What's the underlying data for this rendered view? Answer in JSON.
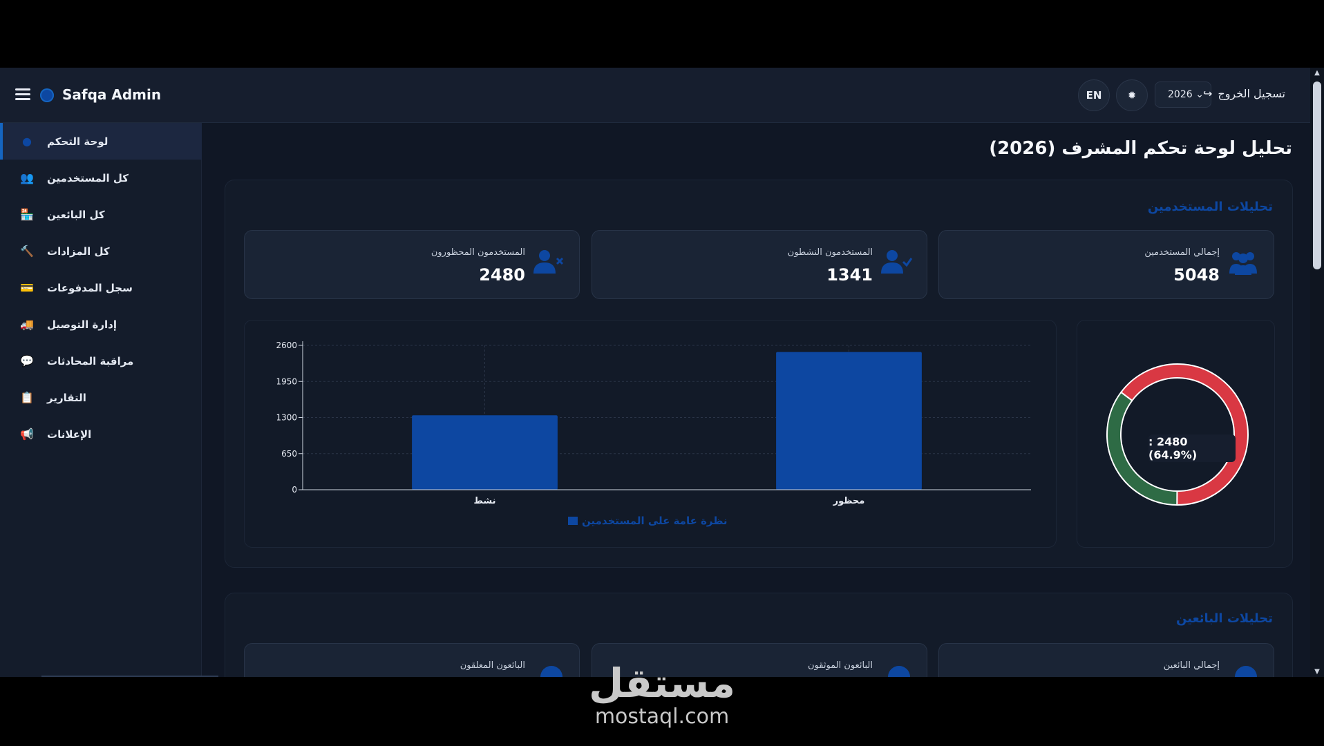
{
  "app": {
    "brand": "Safqa Admin"
  },
  "topbar": {
    "logout_label": "تسجيل الخروج",
    "logout_icon": "↪",
    "year": "2026",
    "lang": "EN",
    "settings_icon": "✹"
  },
  "sidebar": {
    "items": [
      {
        "label": "لوحة التحكم",
        "icon": "●",
        "active": true
      },
      {
        "label": "كل المستخدمين",
        "icon": "👥"
      },
      {
        "label": "كل البائعين",
        "icon": "🏪"
      },
      {
        "label": "كل المزادات",
        "icon": "🔨"
      },
      {
        "label": "سجل المدفوعات",
        "icon": "💳"
      },
      {
        "label": "إدارة التوصيل",
        "icon": "🚚"
      },
      {
        "label": "مراقبة المحادثات",
        "icon": "💬"
      },
      {
        "label": "التقارير",
        "icon": "📋"
      },
      {
        "label": "الإعلانات",
        "icon": "📢"
      }
    ]
  },
  "page": {
    "title": "تحليل لوحة تحكم المشرف (2026)"
  },
  "users_panel": {
    "title": "تحليلات المستخدمين",
    "cards": [
      {
        "label": "المستخدمون المحظورون",
        "value": "2480",
        "icon": "user-block-icon"
      },
      {
        "label": "المستخدمون النشطون",
        "value": "1341",
        "icon": "user-check-icon"
      },
      {
        "label": "إجمالي المستخدمين",
        "value": "5048",
        "icon": "users-icon"
      }
    ]
  },
  "sellers_panel": {
    "title": "تحليلات البائعين",
    "cards": [
      {
        "label": "البائعون المعلقون"
      },
      {
        "label": "البائعون الموثقون"
      },
      {
        "label": "إجمالي البائعين"
      }
    ]
  },
  "chart_data": [
    {
      "type": "bar",
      "categories": [
        "نشط",
        "محظور"
      ],
      "series": [
        {
          "name": "نظرة عامة على المستخدمين",
          "values": [
            1341,
            2480
          ],
          "color": "#0d47a1"
        }
      ],
      "ylim": [
        0,
        2600
      ],
      "yticks": [
        0,
        650,
        1300,
        1950,
        2600
      ],
      "grid": true,
      "legend": "bottom"
    },
    {
      "type": "pie",
      "donut": true,
      "slices": [
        {
          "label": "",
          "value": 2480,
          "color": "#d93843"
        },
        {
          "label": "",
          "value": 1341,
          "color": "#2e6b45"
        }
      ],
      "tooltip": ": 2480 (64.9%)"
    }
  ],
  "watermark": {
    "logo": "مستقل",
    "url": "mostaql.com"
  }
}
